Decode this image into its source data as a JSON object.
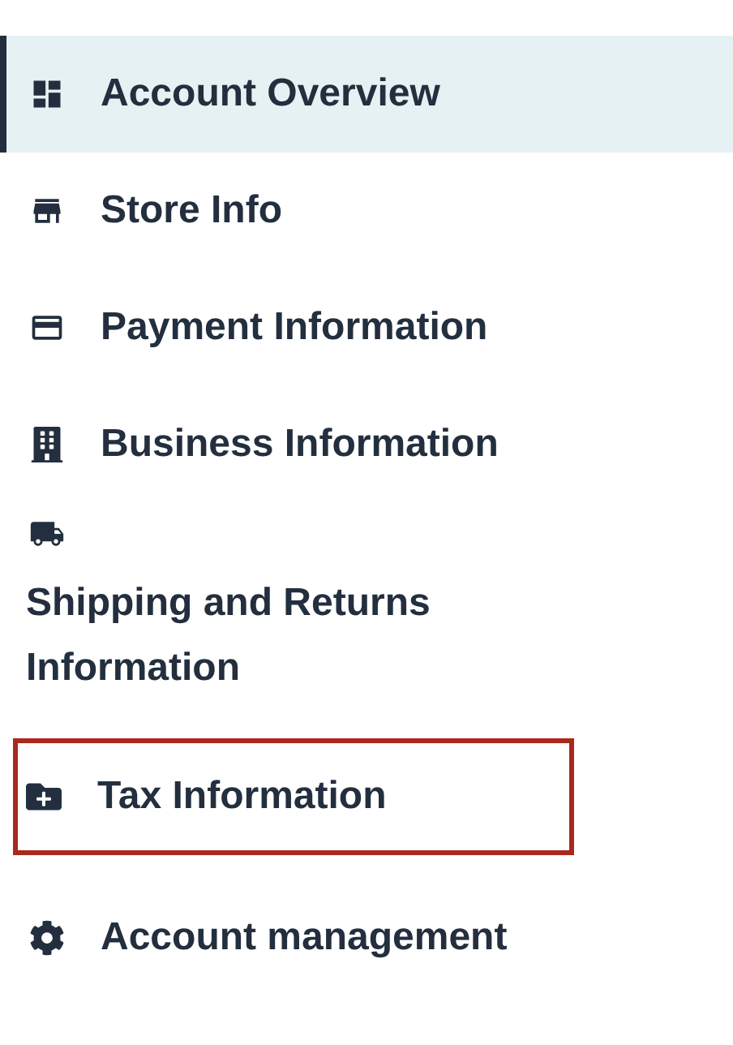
{
  "nav": [
    {
      "label": "Account Overview",
      "selected": true,
      "outlined": false,
      "kind": "inline"
    },
    {
      "label": "Store Info",
      "selected": false,
      "outlined": false,
      "kind": "inline"
    },
    {
      "label": "Payment Information",
      "selected": false,
      "outlined": false,
      "kind": "inline"
    },
    {
      "label": "Business Information",
      "selected": false,
      "outlined": false,
      "kind": "inline"
    },
    {
      "label": "Shipping and Returns Information",
      "selected": false,
      "outlined": false,
      "kind": "stacked"
    },
    {
      "label": "Tax Information",
      "selected": false,
      "outlined": true,
      "kind": "inline"
    },
    {
      "label": "Account management",
      "selected": false,
      "outlined": false,
      "kind": "inline"
    }
  ]
}
